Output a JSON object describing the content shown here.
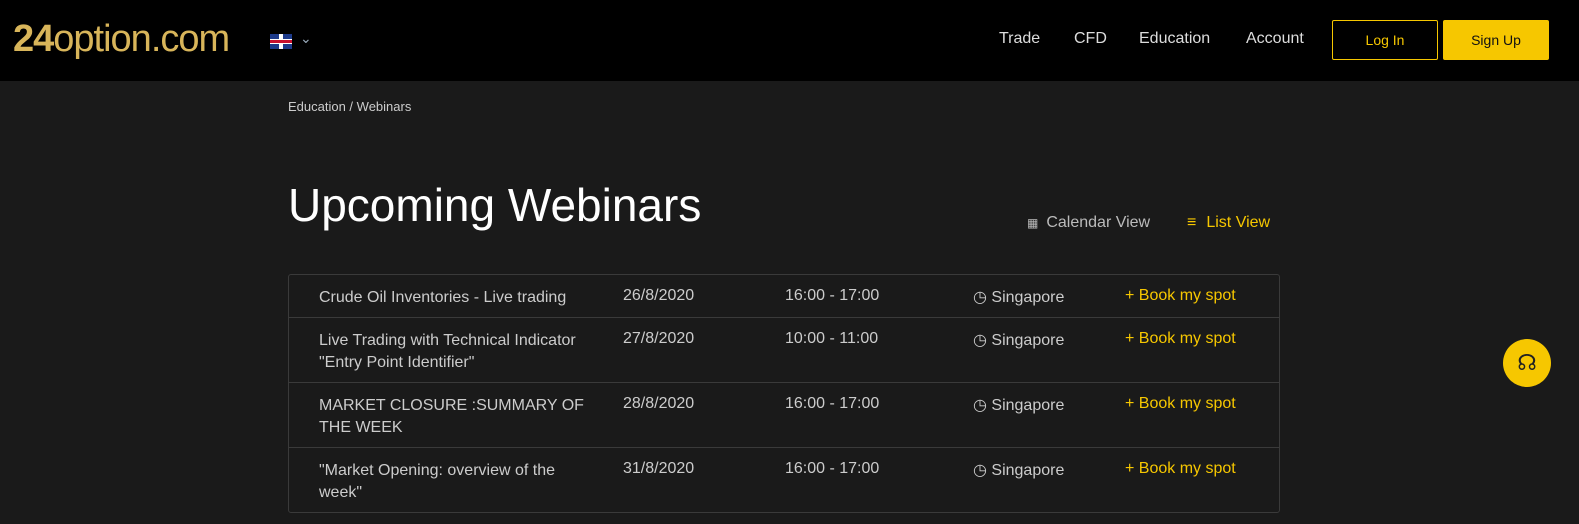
{
  "header": {
    "logo": "24option.com",
    "logo_num": "24",
    "logo_text": "option.com",
    "nav": [
      "Trade",
      "CFD",
      "Education",
      "Account"
    ],
    "login": "Log In",
    "signup": "Sign Up"
  },
  "breadcrumb": "Education / Webinars",
  "title": "Upcoming Webinars",
  "views": {
    "calendar": "Calendar View",
    "list": "List View"
  },
  "webinars": [
    {
      "title": "Crude Oil Inventories - Live trading",
      "date": "26/8/2020",
      "time": "16:00 - 17:00",
      "location": "Singapore",
      "action": "Book my spot"
    },
    {
      "title": "Live Trading with Technical Indicator \"Entry Point Identifier\"",
      "date": "27/8/2020",
      "time": "10:00 - 11:00",
      "location": "Singapore",
      "action": "Book my spot"
    },
    {
      "title": "MARKET CLOSURE :SUMMARY OF THE WEEK",
      "date": "28/8/2020",
      "time": "16:00 - 17:00",
      "location": "Singapore",
      "action": "Book my spot"
    },
    {
      "title": "\"Market Opening: overview of the week\"",
      "date": "31/8/2020",
      "time": "16:00 - 17:00",
      "location": "Singapore",
      "action": "Book my spot"
    }
  ]
}
